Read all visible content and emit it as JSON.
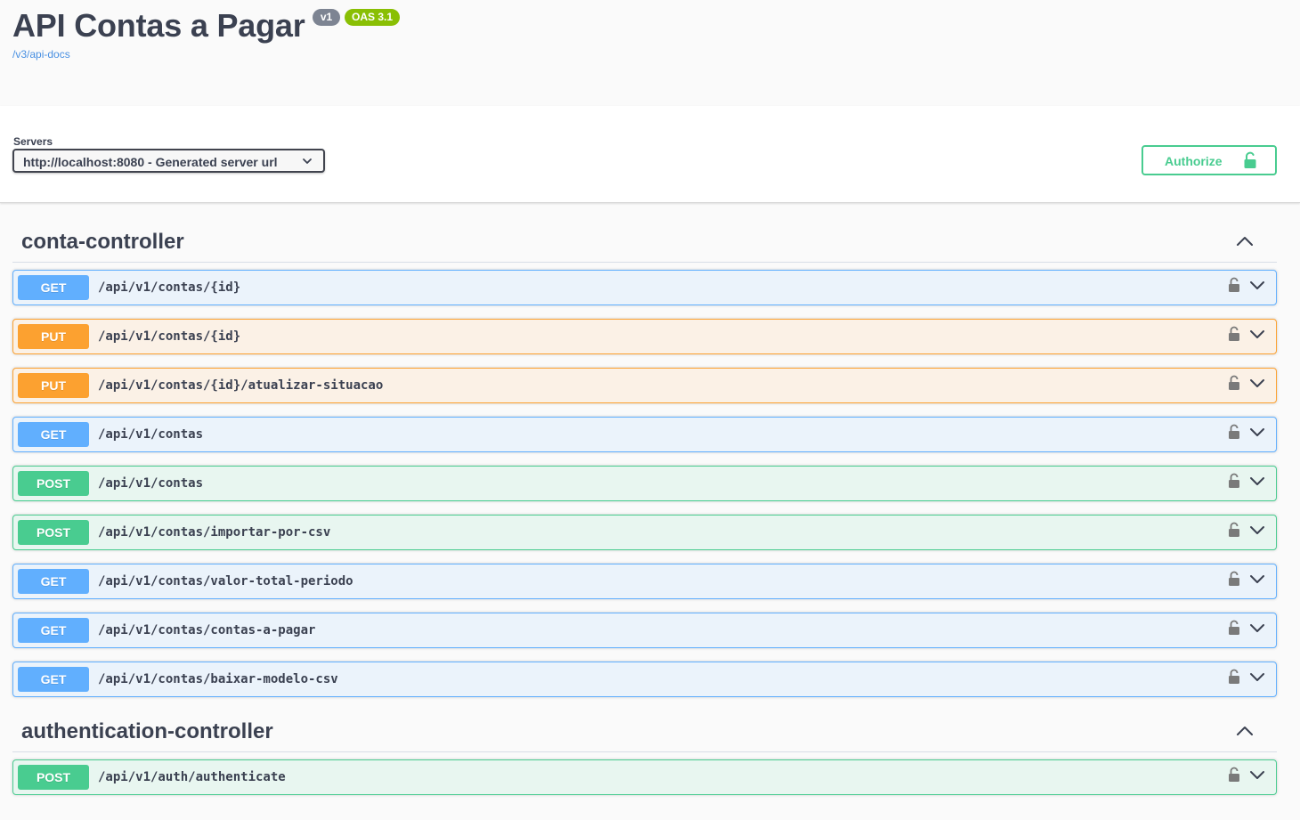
{
  "info": {
    "title": "API Contas a Pagar",
    "version_badge": "v1",
    "oas_badge": "OAS 3.1",
    "spec_link": "/v3/api-docs"
  },
  "servers": {
    "label": "Servers",
    "selected": "http://localhost:8080 - Generated server url"
  },
  "authorize": {
    "label": "Authorize"
  },
  "colors": {
    "get": "#61affe",
    "put": "#fca130",
    "post": "#49cc90",
    "text": "#3b4151",
    "link": "#4990e2",
    "oas_badge": "#89bf04",
    "version_badge": "#7d8492"
  },
  "icons": {
    "lock": "lock-icon",
    "chevron_down": "chevron-down-icon",
    "chevron_up": "chevron-up-icon"
  },
  "tags": [
    {
      "name": "conta-controller",
      "operations": [
        {
          "method": "GET",
          "path": "/api/v1/contas/{id}"
        },
        {
          "method": "PUT",
          "path": "/api/v1/contas/{id}"
        },
        {
          "method": "PUT",
          "path": "/api/v1/contas/{id}/atualizar-situacao"
        },
        {
          "method": "GET",
          "path": "/api/v1/contas"
        },
        {
          "method": "POST",
          "path": "/api/v1/contas"
        },
        {
          "method": "POST",
          "path": "/api/v1/contas/importar-por-csv"
        },
        {
          "method": "GET",
          "path": "/api/v1/contas/valor-total-periodo"
        },
        {
          "method": "GET",
          "path": "/api/v1/contas/contas-a-pagar"
        },
        {
          "method": "GET",
          "path": "/api/v1/contas/baixar-modelo-csv"
        }
      ]
    },
    {
      "name": "authentication-controller",
      "operations": [
        {
          "method": "POST",
          "path": "/api/v1/auth/authenticate"
        }
      ]
    }
  ]
}
